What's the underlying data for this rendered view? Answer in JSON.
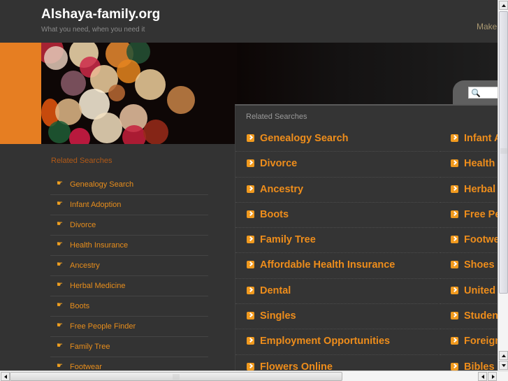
{
  "header": {
    "site_title": "Alshaya-family.org",
    "tagline": "What you need, when you need it",
    "top_link": "Make"
  },
  "search": {
    "icon": "magnifier-icon",
    "value": ""
  },
  "sidebar": {
    "title": "Related Searches",
    "bullet_icon": "pointing-hand-icon",
    "items": [
      "Genealogy Search",
      "Infant Adoption",
      "Divorce",
      "Health Insurance",
      "Ancestry",
      "Herbal Medicine",
      "Boots",
      "Free People Finder",
      "Family Tree",
      "Footwear"
    ]
  },
  "panel": {
    "title": "Related Searches",
    "bullet_icon": "orange-arrow-box-icon",
    "column_a": [
      "Genealogy Search",
      "Divorce",
      "Ancestry",
      "Boots",
      "Family Tree",
      "Affordable Health Insurance",
      "Dental",
      "Singles",
      "Employment Opportunities",
      "Flowers Online"
    ],
    "column_b": [
      "Infant A",
      "Health",
      "Herbal",
      "Free Pe",
      "Footwe",
      "Shoes",
      "United",
      "Studen",
      "Foreign",
      "Bibles"
    ]
  },
  "colors": {
    "accent_orange": "#e67e22",
    "link_orange": "#ee8d1b",
    "background": "#333333"
  }
}
